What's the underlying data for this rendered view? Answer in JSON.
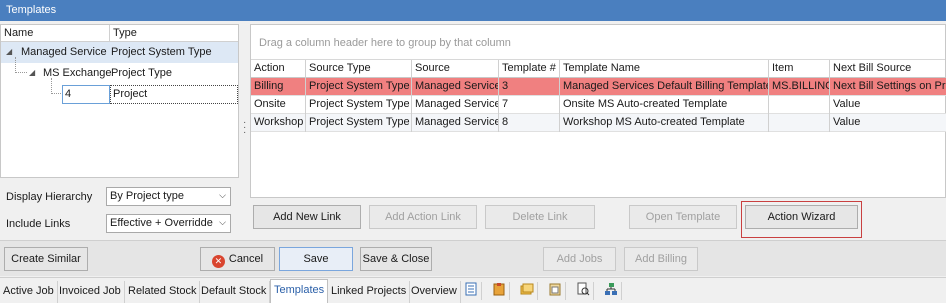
{
  "window": {
    "title": "Templates"
  },
  "tree": {
    "columns": [
      "Name",
      "Type"
    ],
    "rows": [
      {
        "name": "Managed Service",
        "type": "Project System Type"
      },
      {
        "name": "MS Exchange",
        "type": "Project Type"
      },
      {
        "name": "4",
        "type": "Project"
      }
    ]
  },
  "form": {
    "display_hierarchy_label": "Display Hierarchy",
    "display_hierarchy_value": "By Project type",
    "include_links_label": "Include Links",
    "include_links_value": "Effective + Overridde"
  },
  "grid": {
    "group_hint": "Drag a column header here to group by that column",
    "columns": [
      "Action",
      "Source Type",
      "Source",
      "Template #",
      "Template Name",
      "Item",
      "Next Bill Source"
    ],
    "rows": [
      [
        "Billing",
        "Project System Type",
        "Managed Service",
        "3",
        "Managed Services Default Billing Template",
        "MS.BILLING",
        "Next Bill Settings on Pro"
      ],
      [
        "Onsite",
        "Project System Type",
        "Managed Service",
        "7",
        "Onsite MS Auto-created Template",
        "",
        "Value"
      ],
      [
        "Workshop",
        "Project System Type",
        "Managed Service",
        "8",
        "Workshop MS Auto-created Template",
        "",
        "Value"
      ]
    ]
  },
  "link_buttons": {
    "add_new_link": "Add New Link",
    "add_action_link": "Add Action Link",
    "delete_link": "Delete Link",
    "open_template": "Open Template",
    "action_wizard": "Action Wizard"
  },
  "bottom_buttons": {
    "create_similar": "Create Similar",
    "cancel": "Cancel",
    "save": "Save",
    "save_close": "Save & Close",
    "add_jobs": "Add Jobs",
    "add_billing": "Add Billing"
  },
  "tabs": [
    "Active Job",
    "Invoiced Job",
    "Related Stock",
    "Default Stock",
    "Templates",
    "Linked Projects",
    "Overview"
  ],
  "tab_icons": [
    "notes-icon",
    "clipboard-icon",
    "folders-icon",
    "paste-icon",
    "search-document-icon",
    "network-icon"
  ],
  "colors": {
    "title_bar": "#4a7fbf",
    "highlight_row": "#f08080",
    "active_tab_text": "#2a5fa8"
  }
}
